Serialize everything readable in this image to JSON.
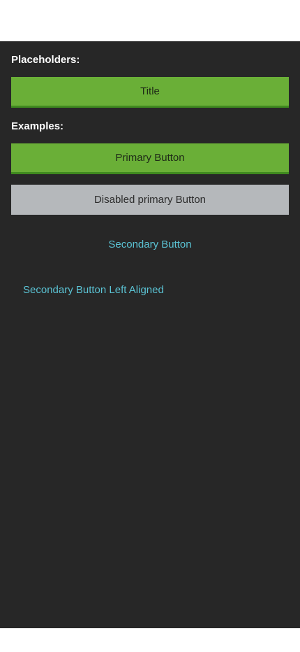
{
  "colors": {
    "background": "#272727",
    "primary": "#6aaf37",
    "primary_underline": "#3f8a1f",
    "disabled": "#b5b8bb",
    "secondary_text": "#5bc3d4",
    "heading_text": "#ffffff"
  },
  "sections": {
    "placeholders_title": "Placeholders:",
    "examples_title": "Examples:"
  },
  "buttons": {
    "title_placeholder": "Title",
    "primary": "Primary Button",
    "disabled_primary": "Disabled primary Button",
    "secondary": "Secondary Button",
    "secondary_left": "Secondary Button Left Aligned"
  }
}
